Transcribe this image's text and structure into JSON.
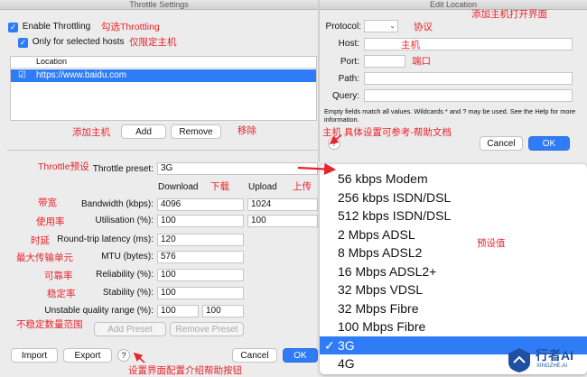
{
  "left": {
    "window_title": "Throttle Settings",
    "enable_label": "Enable Throttling",
    "selected_hosts_label": "Only for selected hosts",
    "location_header": "Location",
    "host_row": "https://www.baidu.com",
    "add_btn": "Add",
    "remove_btn": "Remove",
    "preset_label": "Throttle preset:",
    "preset_value": "3G",
    "download_header": "Download",
    "upload_header": "Upload",
    "bandwidth_label": "Bandwidth (kbps):",
    "bandwidth_down": "4096",
    "bandwidth_up": "1024",
    "utilisation_label": "Utilisation (%):",
    "utilisation_down": "100",
    "utilisation_up": "100",
    "latency_label": "Round-trip latency (ms):",
    "latency_value": "120",
    "mtu_label": "MTU (bytes):",
    "mtu_value": "576",
    "reliability_label": "Reliability (%):",
    "reliability_value": "100",
    "stability_label": "Stability (%):",
    "stability_value": "100",
    "unstable_label": "Unstable quality range (%):",
    "unstable_min": "100",
    "unstable_max": "100",
    "add_preset_btn": "Add Preset",
    "remove_preset_btn": "Remove Preset",
    "import_btn": "Import",
    "export_btn": "Export",
    "help": "?",
    "cancel_btn": "Cancel",
    "ok_btn": "OK"
  },
  "right": {
    "window_title": "Edit Location",
    "protocol_label": "Protocol:",
    "host_label": "Host:",
    "port_label": "Port:",
    "path_label": "Path:",
    "query_label": "Query:",
    "note": "Empty fields match all values. Wildcards * and ? may be used. See the Help for more information.",
    "help": "?",
    "cancel_btn": "Cancel",
    "ok_btn": "OK"
  },
  "presets": {
    "items": [
      "56 kbps Modem",
      "256 kbps ISDN/DSL",
      "512 kbps ISDN/DSL",
      "2 Mbps ADSL",
      "8 Mbps ADSL2",
      "16 Mbps ADSL2+",
      "32 Mbps VDSL",
      "32 Mbps Fibre",
      "100 Mbps Fibre",
      "3G",
      "4G"
    ],
    "selected": "3G",
    "check": "✓"
  },
  "annotations": {
    "enable": "勾选Throttling",
    "selected_hosts": "仅限定主机",
    "add_host": "添加主机",
    "remove": "移除",
    "preset": "Throttle预设",
    "download": "下载",
    "upload": "上传",
    "bandwidth": "带宽",
    "utilisation": "使用率",
    "latency": "时延",
    "mtu": "最大传输单元",
    "reliability": "可靠率",
    "stability": "稳定率",
    "unstable": "不稳定数量范围",
    "help_button": "设置界面配置介绍帮助按钮",
    "open_add_host": "添加主机打开界面",
    "protocol": "协议",
    "host": "主机",
    "port": "端口",
    "host_help": "主机 具体设置可参考-帮助文档",
    "preset_values": "预设值"
  },
  "watermark": {
    "brand": "行者AI",
    "sub": "XINGZHE.AI"
  }
}
